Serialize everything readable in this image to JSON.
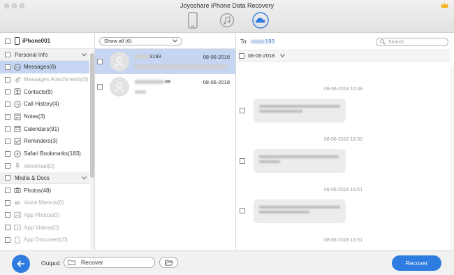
{
  "window": {
    "title": "Joyoshare iPhone Data Recovery"
  },
  "modes": [
    {
      "name": "recover-from-ios-device",
      "icon": "phone-icon",
      "active": false
    },
    {
      "name": "recover-from-itunes",
      "icon": "music-note-icon",
      "active": false
    },
    {
      "name": "recover-from-icloud",
      "icon": "cloud-icon",
      "active": true
    }
  ],
  "sidebar": {
    "device": "iPhone001",
    "sections": [
      {
        "label": "Personal Info",
        "items": [
          {
            "label": "Messages(6)",
            "icon": "message-icon",
            "active": true,
            "dim": false
          },
          {
            "label": "Messages Attachments(0)",
            "icon": "paperclip-icon",
            "active": false,
            "dim": true
          },
          {
            "label": "Contacts(9)",
            "icon": "contact-icon",
            "active": false,
            "dim": false
          },
          {
            "label": "Call History(4)",
            "icon": "clock-icon",
            "active": false,
            "dim": false
          },
          {
            "label": "Notes(3)",
            "icon": "note-icon",
            "active": false,
            "dim": false
          },
          {
            "label": "Calendars(91)",
            "icon": "calendar-icon",
            "active": false,
            "dim": false
          },
          {
            "label": "Reminders(3)",
            "icon": "reminder-icon",
            "active": false,
            "dim": false
          },
          {
            "label": "Safari Bookmarks(183)",
            "icon": "compass-icon",
            "active": false,
            "dim": false
          },
          {
            "label": "Voicemail(0)",
            "icon": "microphone-icon",
            "active": false,
            "dim": true
          }
        ]
      },
      {
        "label": "Media & Docs",
        "items": [
          {
            "label": "Photos(48)",
            "icon": "camera-icon",
            "active": false,
            "dim": false
          },
          {
            "label": "Voice Memos(0)",
            "icon": "waveform-icon",
            "active": false,
            "dim": true
          },
          {
            "label": "App Photos(0)",
            "icon": "image-icon",
            "active": false,
            "dim": true
          },
          {
            "label": "App Videos(0)",
            "icon": "video-icon",
            "active": false,
            "dim": true
          },
          {
            "label": "App Document(0)",
            "icon": "document-icon",
            "active": false,
            "dim": true
          }
        ]
      }
    ]
  },
  "list": {
    "filter": "Show all (6)",
    "conversations": [
      {
        "number_suffix": "3193",
        "date": "08-06-2018",
        "active": true
      },
      {
        "number_suffix": "88",
        "date": "08-06-2018",
        "active": false
      }
    ]
  },
  "search": {
    "placeholder": "Search"
  },
  "detail": {
    "to_label": "To:",
    "to_suffix": "193",
    "date_group": "08-06-2018",
    "messages": [
      {
        "time": "08-06-2018 16:49"
      },
      {
        "time": "08-06-2018 16:50"
      },
      {
        "time": "08-06-2018 16:51"
      },
      {
        "time": "08-06-2018 16:51"
      }
    ]
  },
  "bottom": {
    "output_label": "Output:",
    "output_path": "Recover",
    "recover_label": "Recover"
  },
  "colors": {
    "accent": "#2f7ce0",
    "selection": "#c6d6f2"
  }
}
